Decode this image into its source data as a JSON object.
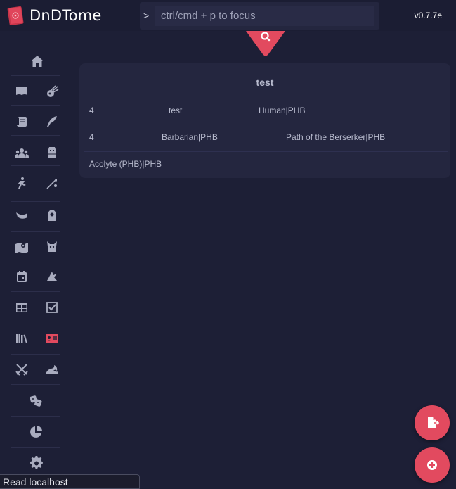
{
  "app": {
    "name": "DnDTome",
    "version": "v0.7.7e"
  },
  "omnibox": {
    "prompt": ">",
    "placeholder": "ctrl/cmd + p to focus",
    "value": ""
  },
  "card": {
    "title": "test",
    "rows": [
      [
        "4",
        "test",
        "Human|PHB"
      ],
      [
        "4",
        "Barbarian|PHB",
        "Path of the Berserker|PHB"
      ],
      [
        "Acolyte (PHB)|PHB"
      ]
    ]
  },
  "sidebar": {
    "items": [
      {
        "name": "home-icon"
      },
      {
        "name": "spellbook-icon"
      },
      {
        "name": "meteor-icon"
      },
      {
        "name": "scroll-icon"
      },
      {
        "name": "feather-icon"
      },
      {
        "name": "users-icon"
      },
      {
        "name": "monster-icon"
      },
      {
        "name": "person-icon"
      },
      {
        "name": "arrow-icon"
      },
      {
        "name": "horn-icon"
      },
      {
        "name": "hooded-icon"
      },
      {
        "name": "map-icon"
      },
      {
        "name": "demon-icon"
      },
      {
        "name": "calendar-icon"
      },
      {
        "name": "rune-icon"
      },
      {
        "name": "table-icon"
      },
      {
        "name": "checkbox-icon"
      },
      {
        "name": "books-icon"
      },
      {
        "name": "id-card-icon"
      },
      {
        "name": "crossed-swords-icon"
      },
      {
        "name": "wave-icon"
      },
      {
        "name": "dice-icon"
      },
      {
        "name": "chart-pie-icon"
      },
      {
        "name": "gear-icon"
      }
    ]
  },
  "colors": {
    "accent": "#e24a5f",
    "background": "#1d1f36",
    "card": "#24263f",
    "icon": "#a9acbf"
  },
  "status_bar": {
    "text": "Read localhost"
  }
}
